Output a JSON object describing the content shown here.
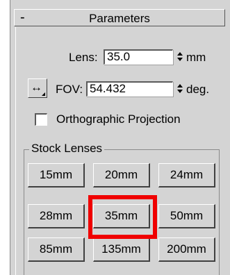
{
  "rollout": {
    "collapse_symbol": "-",
    "title": "Parameters"
  },
  "lens": {
    "label": "Lens:",
    "value": "35.0",
    "unit": "mm"
  },
  "fov": {
    "direction_icon": "horizontal-double-arrow",
    "label": "FOV:",
    "value": "54.432",
    "unit": "deg."
  },
  "ortho": {
    "label": "Orthographic Projection",
    "checked": false
  },
  "stock_lenses": {
    "title": "Stock Lenses",
    "buttons": [
      "15mm",
      "20mm",
      "24mm",
      "28mm",
      "35mm",
      "50mm",
      "85mm",
      "135mm",
      "200mm"
    ],
    "highlighted": "35mm",
    "highlight_color": "#f00000"
  }
}
